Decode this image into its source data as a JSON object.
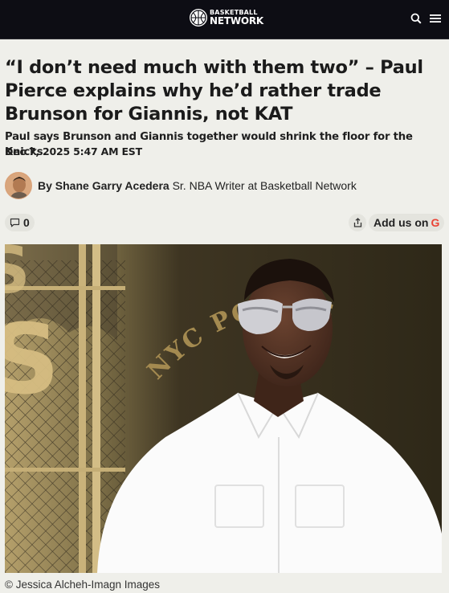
{
  "site": {
    "logo_line1": "BASKETBALL",
    "logo_line2": "NETWORK",
    "icons": [
      "search-icon",
      "menu-icon"
    ]
  },
  "article": {
    "headline": "“I don’t need much with them two” – Paul Pierce explains why he’d rather trade Brunson for Giannis, not KAT",
    "subhead": "Paul says Brunson and Giannis together would shrink the floor for the Knicks.",
    "date": "Dec 7, 2025 5:47 AM EST",
    "byline": {
      "prefix": "By",
      "author": "Shane Garry Acedera",
      "role": "Sr. NBA Writer at Basketball Network"
    },
    "comments_count": "0",
    "add_us_label": "Add us on",
    "google_letter": "G",
    "image": {
      "sign_text": "NYC PO ODS",
      "caption": "© Jessica Alcheh-Imagn Images"
    }
  },
  "colors": {
    "topbar": "#0d0d14",
    "page_bg": "#efefea",
    "google_red": "#ea4335"
  }
}
